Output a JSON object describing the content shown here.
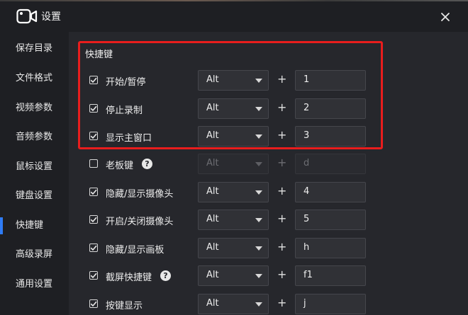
{
  "window": {
    "title": "设置"
  },
  "sidebar": {
    "items": [
      {
        "label": "保存目录",
        "active": false
      },
      {
        "label": "文件格式",
        "active": false
      },
      {
        "label": "视频参数",
        "active": false
      },
      {
        "label": "音频参数",
        "active": false
      },
      {
        "label": "鼠标设置",
        "active": false
      },
      {
        "label": "键盘设置",
        "active": false
      },
      {
        "label": "快捷键",
        "active": true
      },
      {
        "label": "高级录屏",
        "active": false
      },
      {
        "label": "通用设置",
        "active": false
      }
    ]
  },
  "shortcuts": {
    "title": "快捷键",
    "plus": "+",
    "rows": [
      {
        "label": "开始/暂停",
        "checked": true,
        "modifier": "Alt",
        "key": "1",
        "help": false
      },
      {
        "label": "停止录制",
        "checked": true,
        "modifier": "Alt",
        "key": "2",
        "help": false
      },
      {
        "label": "显示主窗口",
        "checked": true,
        "modifier": "Alt",
        "key": "3",
        "help": false
      },
      {
        "label": "老板键",
        "checked": false,
        "modifier": "Alt",
        "key": "d",
        "help": true
      },
      {
        "label": "隐藏/显示摄像头",
        "checked": true,
        "modifier": "Alt",
        "key": "4",
        "help": false
      },
      {
        "label": "开启/关闭摄像头",
        "checked": true,
        "modifier": "Alt",
        "key": "5",
        "help": false
      },
      {
        "label": "隐藏/显示画板",
        "checked": true,
        "modifier": "Alt",
        "key": "h",
        "help": false
      },
      {
        "label": "截屏快捷键",
        "checked": true,
        "modifier": "Alt",
        "key": "f1",
        "help": true
      },
      {
        "label": "按键显示",
        "checked": true,
        "modifier": "Alt",
        "key": "j",
        "help": false
      }
    ],
    "help_glyph": "?"
  },
  "colors": {
    "accent": "#2f7cf6",
    "highlight": "#e81d1d",
    "background": "#26272c",
    "sidebar": "#1e1f23"
  },
  "icons": {
    "app": "camera-icon",
    "close": "close-icon",
    "checkbox": "check-icon",
    "help": "help-icon",
    "dropdown": "chevron-down-icon"
  }
}
